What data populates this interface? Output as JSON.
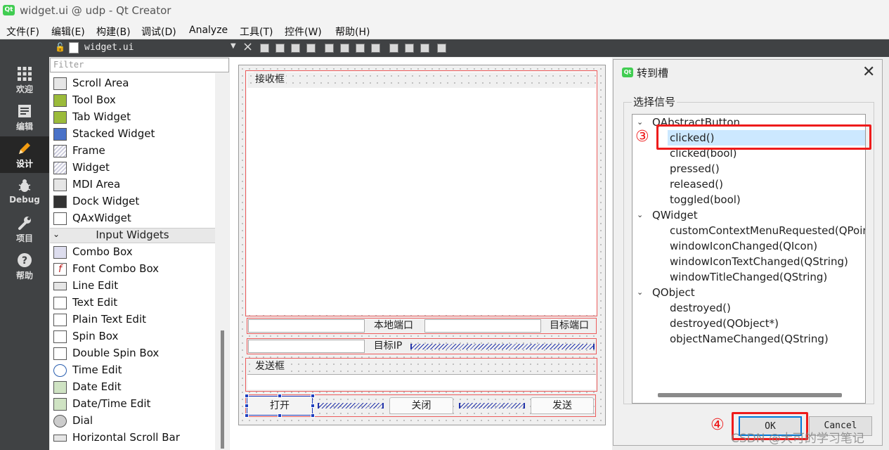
{
  "window": {
    "title": "widget.ui @ udp - Qt Creator",
    "logo": "Qt"
  },
  "menubar": [
    "文件(F)",
    "编辑(E)",
    "构建(B)",
    "调试(D)",
    "Analyze",
    "工具(T)",
    "控件(W)",
    "帮助(H)"
  ],
  "modes": [
    {
      "label": "欢迎",
      "icon": "grid-icon"
    },
    {
      "label": "编辑",
      "icon": "document-icon"
    },
    {
      "label": "设计",
      "icon": "pencil-icon"
    },
    {
      "label": "Debug",
      "icon": "bug-icon"
    },
    {
      "label": "项目",
      "icon": "wrench-icon"
    },
    {
      "label": "帮助",
      "icon": "help-icon"
    }
  ],
  "active_mode": "设计",
  "editor": {
    "file_name": "widget.ui",
    "filter_placeholder": "Filter"
  },
  "widget_box": {
    "items_before": [
      "Scroll Area",
      "Tool Box",
      "Tab Widget",
      "Stacked Widget",
      "Frame",
      "Widget",
      "MDI Area",
      "Dock Widget",
      "QAxWidget"
    ],
    "category": "Input Widgets",
    "items_after": [
      "Combo Box",
      "Font Combo Box",
      "Line Edit",
      "Text Edit",
      "Plain Text Edit",
      "Spin Box",
      "Double Spin Box",
      "Time Edit",
      "Date Edit",
      "Date/Time Edit",
      "Dial",
      "Horizontal Scroll Bar"
    ]
  },
  "form": {
    "receive_group": "接收框",
    "local_port": "本地端口",
    "target_port": "目标端口",
    "target_ip": "目标IP",
    "send_group": "发送框",
    "open_button": "打开",
    "close_button": "关闭",
    "send_button": "发送"
  },
  "dialog": {
    "title": "转到槽",
    "logo": "Qt",
    "group_label": "选择信号",
    "tree": [
      {
        "class": "QAbstractButton",
        "signals": [
          "clicked()",
          "clicked(bool)",
          "pressed()",
          "released()",
          "toggled(bool)"
        ]
      },
      {
        "class": "QWidget",
        "signals": [
          "customContextMenuRequested(QPoint",
          "windowIconChanged(QIcon)",
          "windowIconTextChanged(QString)",
          "windowTitleChanged(QString)"
        ]
      },
      {
        "class": "QObject",
        "signals": [
          "destroyed()",
          "destroyed(QObject*)",
          "objectNameChanged(QString)"
        ]
      }
    ],
    "selected_signal": "clicked()",
    "ok_label": "OK",
    "cancel_label": "Cancel"
  },
  "annotations": {
    "step3": "③",
    "step4": "④"
  },
  "watermark": "CSDN @大可的学习笔记",
  "colors": {
    "annotation": "#ee1b1b",
    "selection": "#cce8ff",
    "mode_bar": "#404244",
    "qt_green": "#41cd52"
  }
}
